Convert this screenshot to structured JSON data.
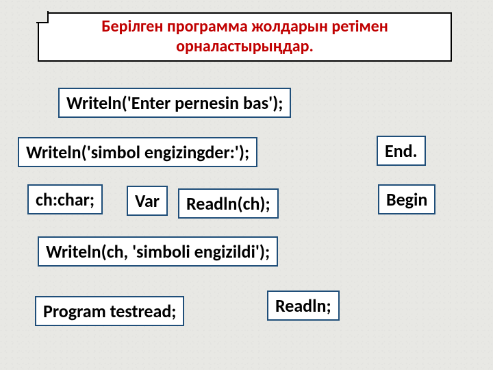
{
  "title": "Берілген программа жолдарын ретімен орналастырыңдар.",
  "blocks": {
    "b1": "Writeln('Enter pernesin bas');",
    "b2": "Writeln('simbol engizingder:');",
    "b3": "End.",
    "b4": "ch:char;",
    "b5": "Var",
    "b6": "Readln(ch);",
    "b7": "Begin",
    "b8": "Writeln(ch, 'simboli engizildi');",
    "b9": "Program testread;",
    "b10": "Readln;"
  }
}
